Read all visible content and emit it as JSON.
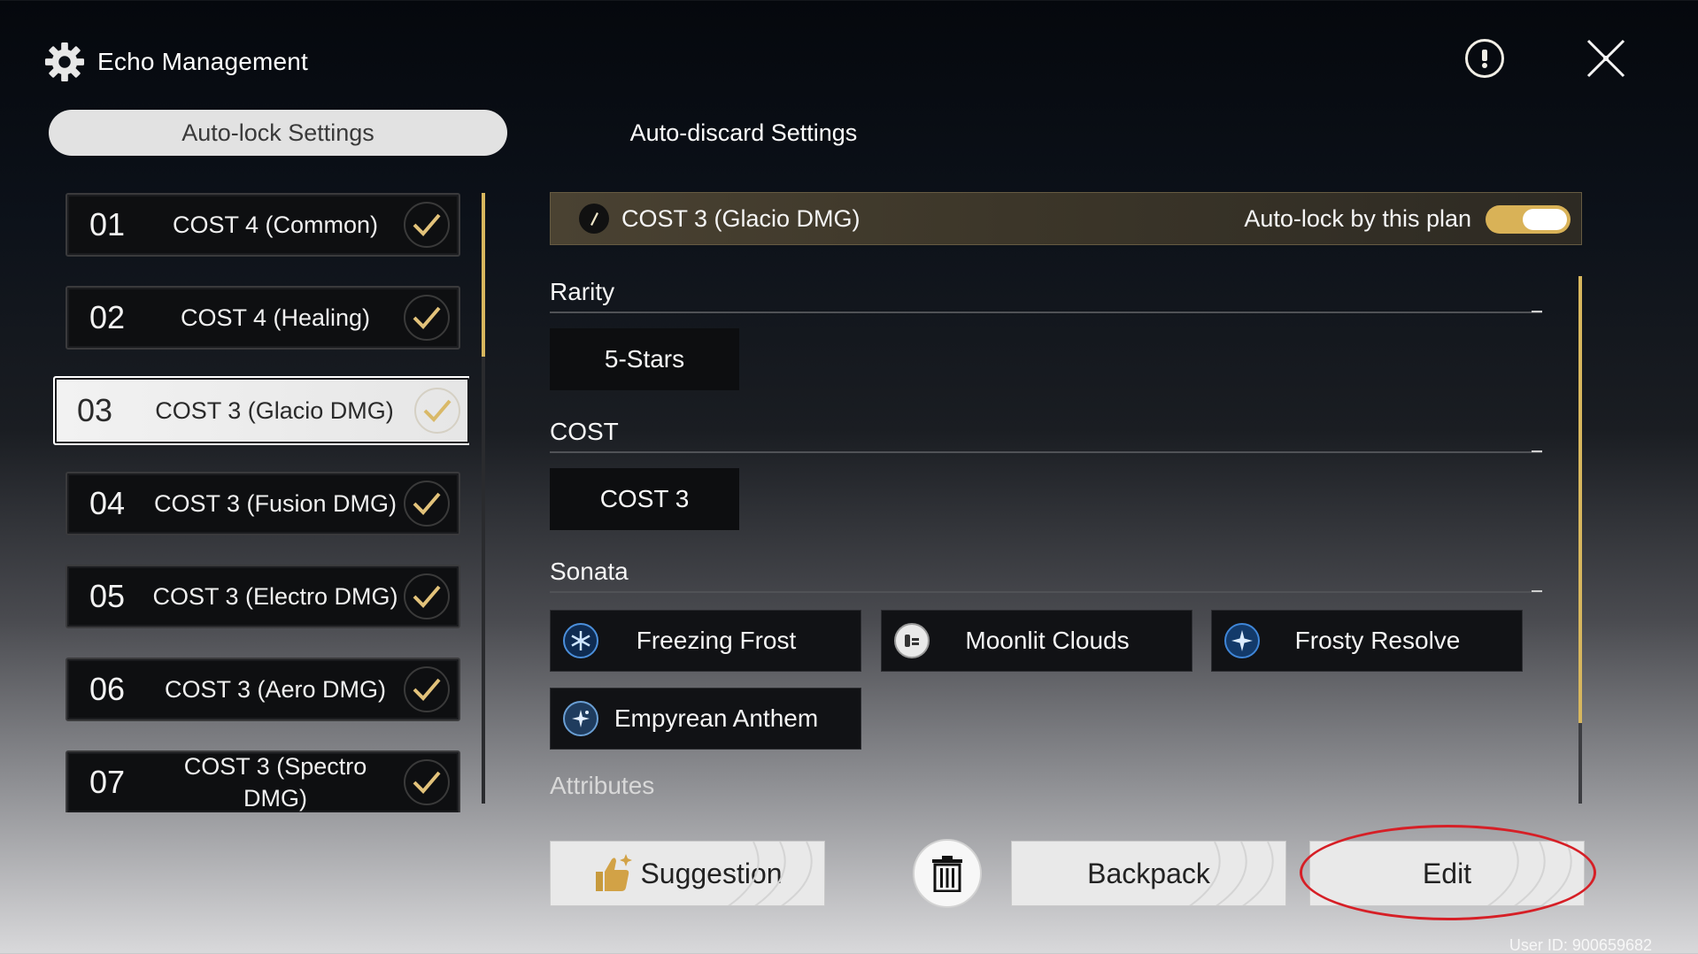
{
  "header": {
    "title": "Echo Management",
    "icon": "gear-icon"
  },
  "tabs": [
    {
      "label": "Auto-lock Settings",
      "active": true
    },
    {
      "label": "Auto-discard Settings",
      "active": false
    }
  ],
  "plans": [
    {
      "num": "01",
      "name": "COST 4 (Common)",
      "checked": true,
      "selected": false
    },
    {
      "num": "02",
      "name": "COST 4 (Healing)",
      "checked": true,
      "selected": false
    },
    {
      "num": "03",
      "name": "COST 3 (Glacio DMG)",
      "checked": true,
      "selected": true
    },
    {
      "num": "04",
      "name": "COST 3 (Fusion DMG)",
      "checked": true,
      "selected": false
    },
    {
      "num": "05",
      "name": "COST 3 (Electro DMG)",
      "checked": true,
      "selected": false
    },
    {
      "num": "06",
      "name": "COST 3 (Aero DMG)",
      "checked": true,
      "selected": false
    },
    {
      "num": "07",
      "name": "COST 3 (Spectro DMG)",
      "checked": true,
      "selected": false
    }
  ],
  "detail": {
    "plan_title": "COST 3 (Glacio DMG)",
    "autolock_label": "Auto-lock by this plan",
    "autolock_on": true,
    "rarity_title": "Rarity",
    "rarity_value": "5-Stars",
    "cost_title": "COST",
    "cost_value": "COST 3",
    "sonata_title": "Sonata",
    "sonatas": [
      {
        "label": "Freezing Frost",
        "icon": "snowflake-icon"
      },
      {
        "label": "Moonlit Clouds",
        "icon": "moon-cloud-icon"
      },
      {
        "label": "Frosty Resolve",
        "icon": "star-compass-icon"
      },
      {
        "label": "Empyrean Anthem",
        "icon": "sparkle-icon"
      }
    ],
    "attributes_title": "Attributes"
  },
  "buttons": {
    "suggestion": "Suggestion",
    "backpack": "Backpack",
    "edit": "Edit"
  },
  "user_id": "User ID: 900659682",
  "colors": {
    "accent_gold": "#d8b75e",
    "annotation_red": "#d61f26"
  }
}
